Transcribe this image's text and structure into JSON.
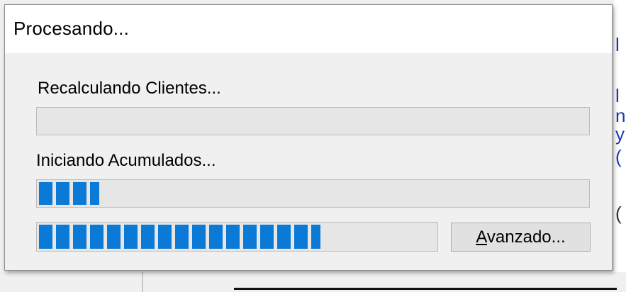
{
  "dialog": {
    "title": "Procesando...",
    "status_1": "Recalculando Clientes...",
    "status_2": "Iniciando Acumulados...",
    "progress_1": 0.0,
    "progress_2": 0.11,
    "progress_3": 0.71,
    "advanced_button": {
      "mnemonic": "A",
      "rest": "vanzado..."
    },
    "accent_color": "#0a7ad6"
  },
  "background": {
    "right_edge_glyphs": [
      "l",
      "l",
      "n",
      "y",
      "(",
      "("
    ]
  }
}
